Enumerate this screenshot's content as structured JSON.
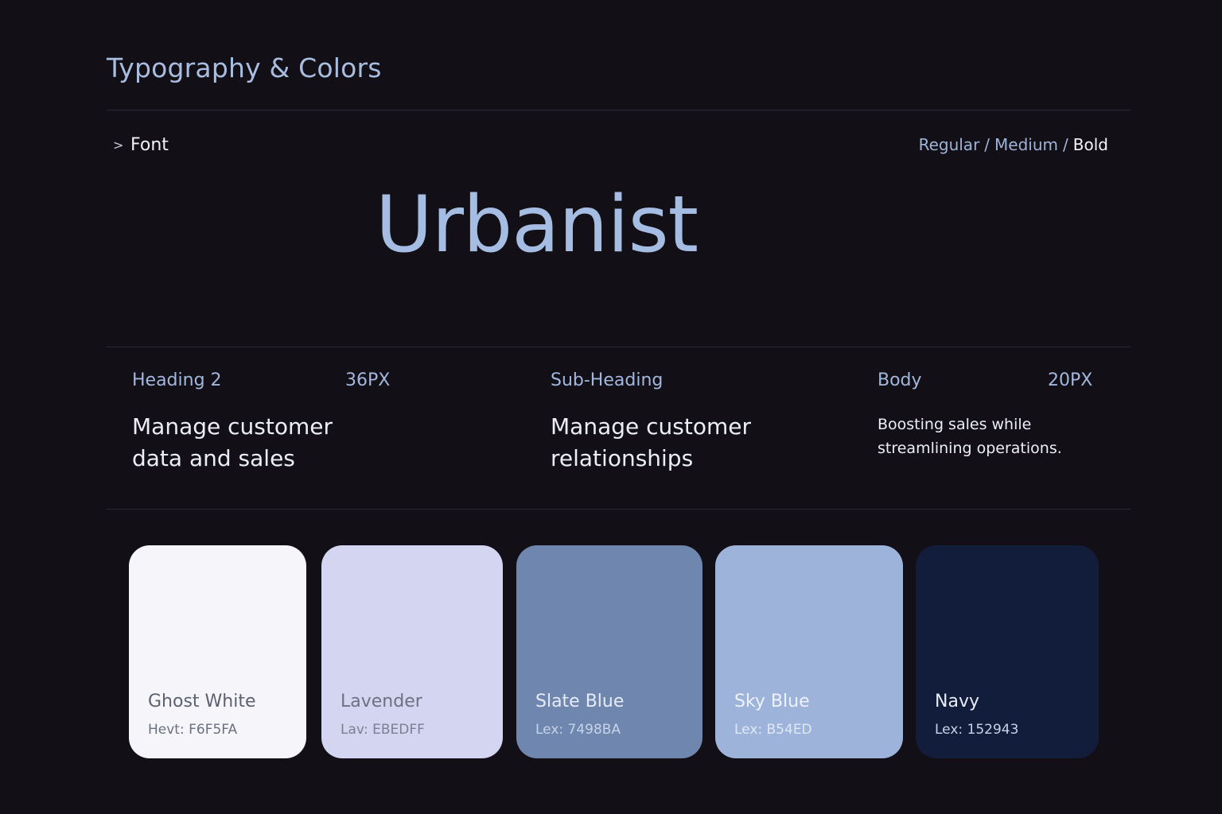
{
  "page_title": "Typography & Colors",
  "font_section": {
    "chevron": ">",
    "label": "Font",
    "weights": {
      "regular": "Regular",
      "medium": "Medium",
      "bold": "Bold",
      "separator": "/"
    },
    "sample": "Urbanist"
  },
  "type_scale": [
    {
      "name": "Heading 2",
      "size": "36PX",
      "sample": "Manage customer data and sales"
    },
    {
      "name": "Sub-Heading",
      "size": "",
      "sample": "Manage customer relationships"
    },
    {
      "name": "Body",
      "size": "20PX",
      "sample": "Boosting sales while streamlining operations."
    }
  ],
  "swatches": [
    {
      "name": "Ghost White",
      "code": "Hevt: F6F5FA",
      "color": "#F6F5FA"
    },
    {
      "name": "Lavender",
      "code": "Lav: EBEDFF",
      "color": "#D3D5F1"
    },
    {
      "name": "Slate Blue",
      "code": "Lex: 7498BA",
      "color": "#6F86AF"
    },
    {
      "name": "Sky Blue",
      "code": "Lex: B54ED",
      "color": "#9DB3DA"
    },
    {
      "name": "Navy",
      "code": "Lex: 152943",
      "color": "#121D3C"
    }
  ]
}
